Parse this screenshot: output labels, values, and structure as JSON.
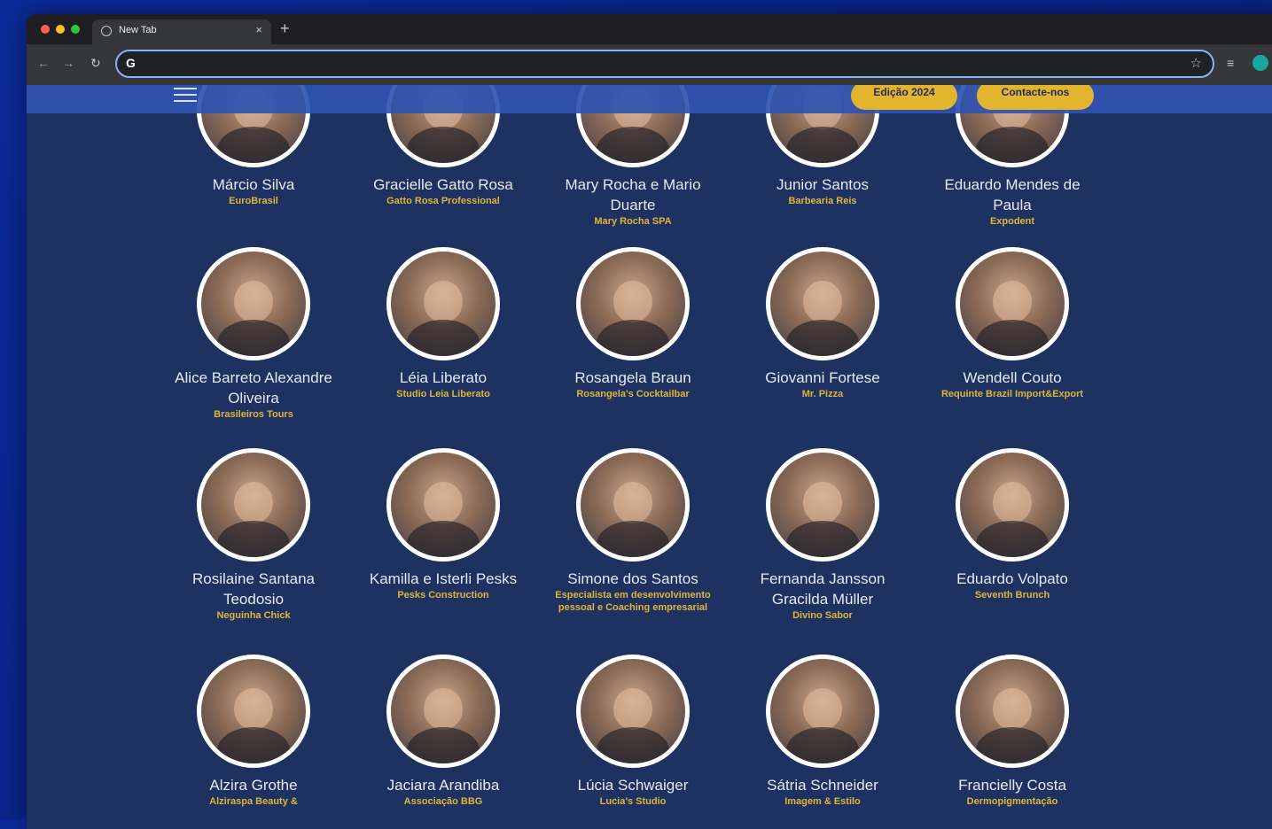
{
  "browser": {
    "tab_title": "New Tab",
    "tab_close": "×",
    "new_tab": "+",
    "omnibox_value": "",
    "omnibox_logo": "G"
  },
  "site": {
    "nav": {
      "edicao_label": "Edição 2024",
      "contact_label": "Contacte-nos"
    },
    "rows": [
      [
        {
          "name": "Márcio Silva",
          "company": "EuroBrasil"
        },
        {
          "name": "Gracielle Gatto Rosa",
          "company": "Gatto Rosa Professional"
        },
        {
          "name": "Mary Rocha e Mario Duarte",
          "company": "Mary Rocha SPA"
        },
        {
          "name": "Junior Santos",
          "company": "Barbearia Reis"
        },
        {
          "name": "Eduardo Mendes de Paula",
          "company": "Expodent"
        }
      ],
      [
        {
          "name": "Alice Barreto Alexandre Oliveira",
          "company": "Brasileiros Tours"
        },
        {
          "name": "Léia Liberato",
          "company": "Studio Leia Liberato"
        },
        {
          "name": "Rosangela Braun",
          "company": "Rosangela's Cocktailbar"
        },
        {
          "name": "Giovanni Fortese",
          "company": "Mr. Pizza"
        },
        {
          "name": "Wendell Couto",
          "company": "Requinte Brazil Import&Export"
        }
      ],
      [
        {
          "name": "Rosilaine Santana Teodosio",
          "company": "Neguinha Chick"
        },
        {
          "name": "Kamilla e Isterli Pesks",
          "company": "Pesks Construction"
        },
        {
          "name": "Simone dos Santos",
          "company": "Especialista em desenvolvimento pessoal e Coaching empresarial"
        },
        {
          "name": "Fernanda Jansson Gracilda Müller",
          "company": "Divino Sabor"
        },
        {
          "name": "Eduardo Volpato",
          "company": "Seventh Brunch"
        }
      ],
      [
        {
          "name": "Alzira Grothe",
          "company": "Alziraspa Beauty &"
        },
        {
          "name": "Jaciara Arandiba",
          "company": "Associação BBG"
        },
        {
          "name": "Lúcia Schwaiger",
          "company": "Lucia's Studio"
        },
        {
          "name": "Sátria Schneider",
          "company": "Imagem & Estilo"
        },
        {
          "name": "Francielly Costa",
          "company": "Dermopigmentação"
        }
      ]
    ]
  },
  "colors": {
    "page_bg": "#1d3260",
    "accent_gold": "#e3b52f",
    "company_text": "#e0b43a",
    "navbar": "#2f54b2"
  },
  "icons": {
    "back": "arrow-left-icon",
    "forward": "arrow-right-icon",
    "reload": "reload-icon",
    "bookmark": "star-icon",
    "extensions": "extensions-icon",
    "menu": "hamburger-menu-icon"
  }
}
